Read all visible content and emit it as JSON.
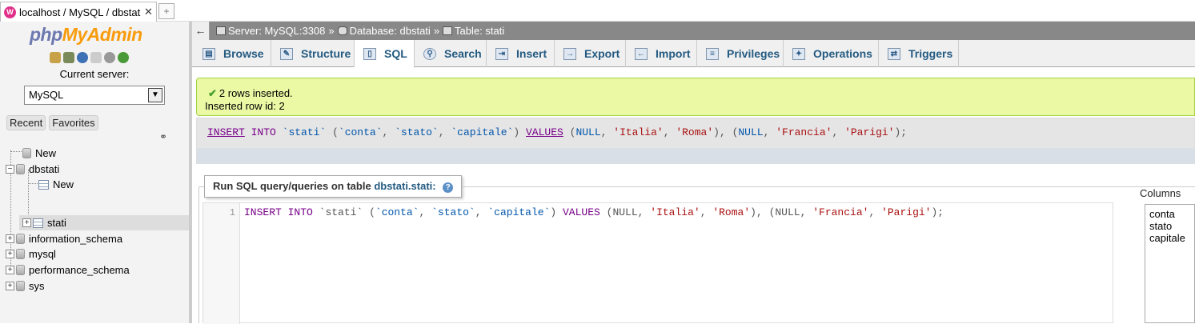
{
  "browser": {
    "tab_title": "localhost / MySQL / dbstati...",
    "close_glyph": "✕"
  },
  "nav": {
    "logo_php": "php",
    "logo_myadmin": "MyAdmin",
    "current_server_label": "Current server:",
    "server_select": "MySQL",
    "buttons": [
      "Recent",
      "Favorites"
    ],
    "tree": [
      {
        "label": "New"
      },
      {
        "label": "dbstati"
      },
      {
        "label": "New"
      },
      {
        "label": "stati"
      },
      {
        "label": "information_schema"
      },
      {
        "label": "mysql"
      },
      {
        "label": "performance_schema"
      },
      {
        "label": "sys"
      }
    ]
  },
  "breadcrumb": {
    "server": "Server: MySQL:3308",
    "database": "Database: dbstati",
    "table": "Table: stati",
    "sep": "»"
  },
  "tabs": [
    {
      "label": "Browse",
      "icon": "browse-icon"
    },
    {
      "label": "Structure",
      "icon": "structure-icon"
    },
    {
      "label": "SQL",
      "icon": "sql-icon",
      "active": true
    },
    {
      "label": "Search",
      "icon": "search-icon"
    },
    {
      "label": "Insert",
      "icon": "insert-icon"
    },
    {
      "label": "Export",
      "icon": "export-icon"
    },
    {
      "label": "Import",
      "icon": "import-icon"
    },
    {
      "label": "Privileges",
      "icon": "privileges-icon"
    },
    {
      "label": "Operations",
      "icon": "operations-icon"
    },
    {
      "label": "Triggers",
      "icon": "triggers-icon"
    }
  ],
  "message": {
    "line1": "2 rows inserted.",
    "line2": "Inserted row id: 2"
  },
  "query": {
    "sql": "INSERT INTO `stati` (`conta`, `stato`, `capitale`) VALUES (NULL, 'Italia', 'Roma'), (NULL, 'Francia', 'Parigi');"
  },
  "sql_form": {
    "legend": "Run SQL query/queries on table",
    "legend_table": "dbstati.stati:",
    "line_number": "1",
    "columns_label": "Columns",
    "columns": [
      "conta",
      "stato",
      "capitale"
    ]
  },
  "colors": {
    "accent": "#235a81",
    "success_bg": "#ebf8a4",
    "breadcrumb_bg": "#888888"
  }
}
